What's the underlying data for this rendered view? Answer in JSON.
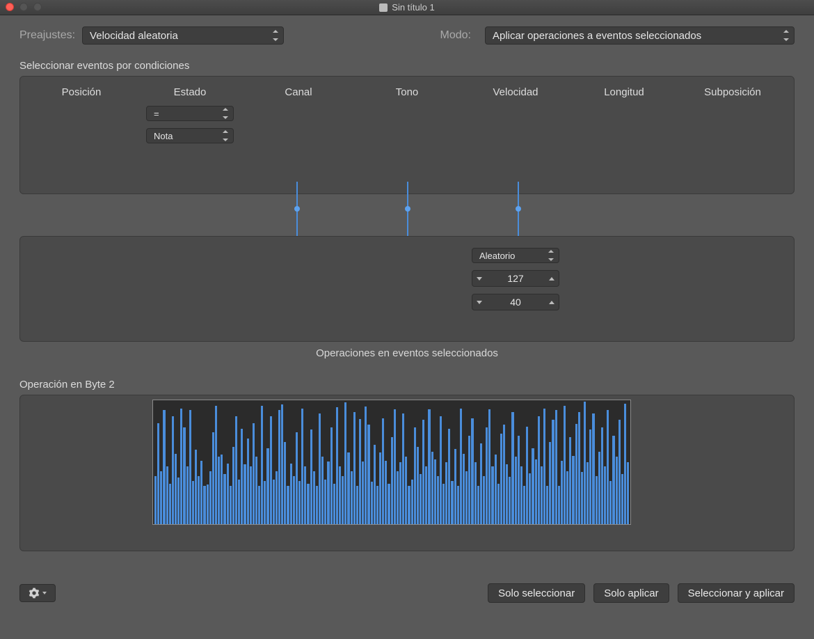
{
  "window": {
    "title": "Sin título 1"
  },
  "header": {
    "preset_label": "Preajustes:",
    "preset_value": "Velocidad aleatoria",
    "mode_label": "Modo:",
    "mode_value": "Aplicar operaciones a eventos seleccionados"
  },
  "conditions": {
    "section_label": "Seleccionar eventos por condiciones",
    "columns": [
      "Posición",
      "Estado",
      "Canal",
      "Tono",
      "Velocidad",
      "Longitud",
      "Subposición"
    ],
    "estado_op": "=",
    "estado_type": "Nota"
  },
  "operations": {
    "section_label": "Operaciones en eventos seleccionados",
    "velocity_mode": "Aleatorio",
    "velocity_hi": "127",
    "velocity_lo": "40"
  },
  "byte2": {
    "section_label": "Operación en Byte 2"
  },
  "footer": {
    "select_only": "Solo seleccionar",
    "apply_only": "Solo aplicar",
    "select_apply": "Seleccionar y aplicar"
  },
  "chart_data": {
    "type": "bar",
    "title": "Operación en Byte 2",
    "xlabel": "",
    "ylabel": "",
    "ylim": [
      0,
      127
    ],
    "values": [
      50,
      105,
      55,
      118,
      60,
      42,
      112,
      73,
      48,
      120,
      100,
      60,
      118,
      45,
      77,
      50,
      66,
      40,
      41,
      55,
      95,
      123,
      70,
      72,
      52,
      63,
      40,
      80,
      112,
      46,
      99,
      62,
      89,
      60,
      105,
      70,
      40,
      123,
      45,
      79,
      112,
      46,
      55,
      118,
      124,
      85,
      40,
      63,
      50,
      95,
      45,
      120,
      60,
      42,
      98,
      55,
      40,
      115,
      70,
      46,
      65,
      100,
      42,
      121,
      60,
      50,
      126,
      74,
      55,
      116,
      40,
      109,
      65,
      122,
      103,
      44,
      82,
      40,
      74,
      110,
      66,
      42,
      90,
      119,
      55,
      64,
      115,
      70,
      40,
      46,
      100,
      80,
      52,
      108,
      60,
      119,
      75,
      67,
      50,
      112,
      42,
      64,
      99,
      45,
      78,
      40,
      120,
      73,
      55,
      92,
      110,
      64,
      40,
      84,
      50,
      100,
      119,
      60,
      72,
      42,
      94,
      103,
      62,
      49,
      116,
      70,
      92,
      60,
      40,
      101,
      53,
      79,
      67,
      112,
      60,
      120,
      40,
      85,
      108,
      118,
      40,
      66,
      123,
      55,
      90,
      71,
      104,
      116,
      54,
      127,
      64,
      98,
      115,
      50,
      75,
      100,
      60,
      118,
      45,
      92,
      70,
      108,
      52,
      125,
      64
    ]
  }
}
